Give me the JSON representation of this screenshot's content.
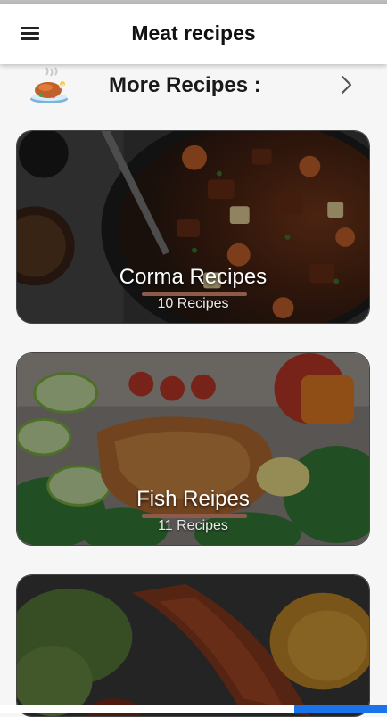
{
  "app": {
    "title": "Meat recipes",
    "menu_icon": "hamburger-menu-icon"
  },
  "more_recipes": {
    "label": "More Recipes :",
    "icon": "roast-turkey-icon",
    "arrow_icon": "chevron-right-icon"
  },
  "cards": [
    {
      "title": "Corma Recipes",
      "count": "10 Recipes"
    },
    {
      "title": "Fish Reipes",
      "count": "11 Recipes"
    },
    {
      "title": "",
      "count": ""
    }
  ],
  "colors": {
    "appbar": "#ffffff",
    "background": "#f6f6f6",
    "underline": "#8d5b4a",
    "bottom_accent": "#1a73e8"
  }
}
